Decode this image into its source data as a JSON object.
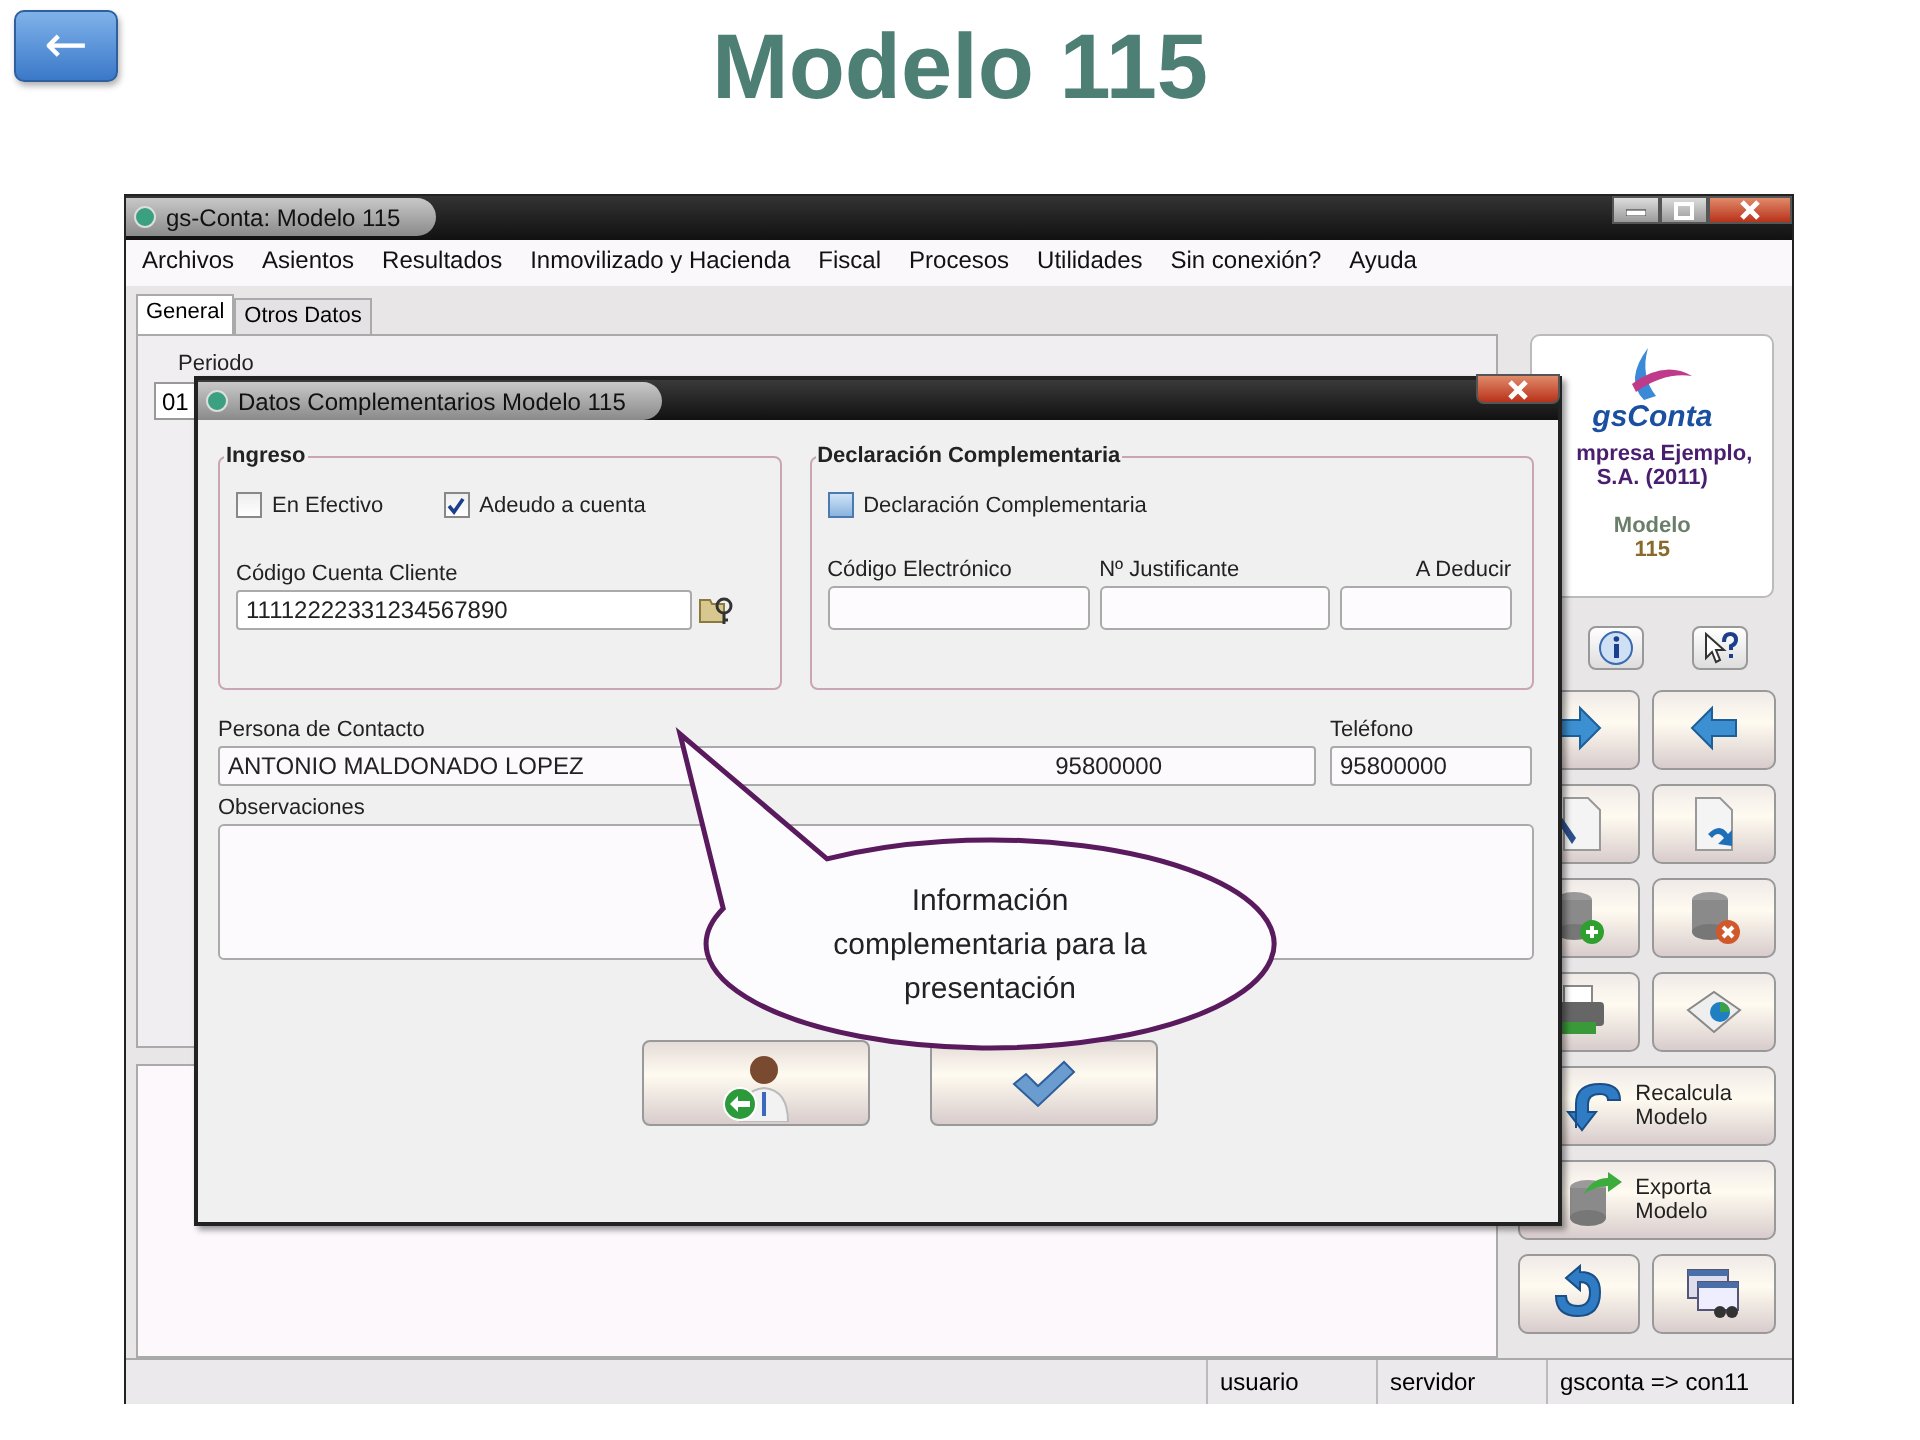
{
  "slide": {
    "back_button": "←",
    "title": "Modelo 115"
  },
  "main_window": {
    "title": "gs-Conta: Modelo 115",
    "menu": [
      "Archivos",
      "Asientos",
      "Resultados",
      "Inmovilizado y Hacienda",
      "Fiscal",
      "Procesos",
      "Utilidades",
      "Sin conexión?",
      "Ayuda"
    ],
    "tabs": [
      {
        "label": "General",
        "selected": true
      },
      {
        "label": "Otros Datos",
        "selected": false
      }
    ],
    "periodo": {
      "label": "Periodo",
      "value": "01"
    },
    "company_card": {
      "logo_text": "gsConta",
      "company": "mpresa Ejemplo,",
      "company_line2": "S.A. (2011)",
      "model_label": "Modelo",
      "model_number": "115"
    },
    "wide_buttons": [
      {
        "label": "Recalcula Modelo"
      },
      {
        "label": "Exporta Modelo"
      }
    ],
    "status_bar": [
      "usuario",
      "servidor",
      "gsconta => con11"
    ]
  },
  "dialog": {
    "title": "Datos Complementarios Modelo 115",
    "ingreso": {
      "title": "Ingreso",
      "checkboxes": [
        {
          "label": "En Efectivo",
          "checked": false
        },
        {
          "label": "Adeudo a cuenta",
          "checked": true
        }
      ],
      "account": {
        "label": "Código Cuenta Cliente",
        "value": "11112222331234567890"
      }
    },
    "complementaria": {
      "title": "Declaración Complementaria",
      "checkbox": {
        "label": "Declaración Complementaria",
        "checked": false
      },
      "fields": [
        {
          "label": "Código Electrónico"
        },
        {
          "label": "Nº Justificante"
        },
        {
          "label": "A Deducir"
        }
      ]
    },
    "contact": {
      "label": "Persona de Contacto",
      "name": "ANTONIO MALDONADO LOPEZ",
      "number": "95800000"
    },
    "phone": {
      "label": "Teléfono",
      "value": "95800000"
    },
    "observations": {
      "label": "Observaciones"
    }
  },
  "callout": {
    "text": "Información complementaria para la presentación"
  }
}
